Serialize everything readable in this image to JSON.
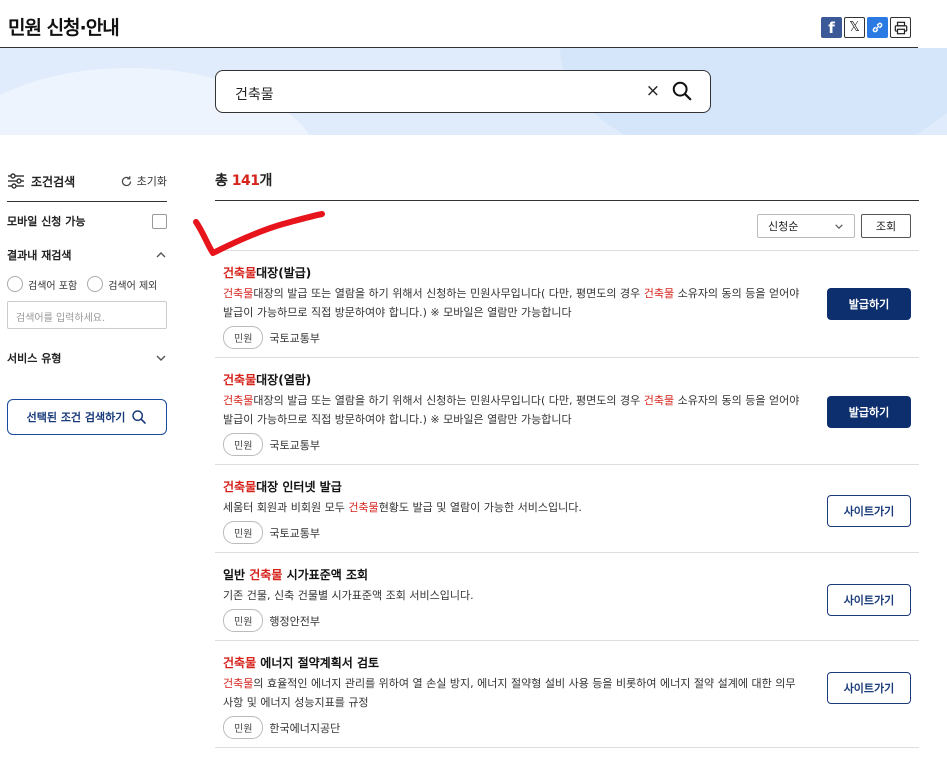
{
  "header": {
    "title": "민원 신청·안내",
    "share": {
      "facebook": "f",
      "x": "𝕏"
    }
  },
  "search": {
    "query": "건축물",
    "clear_label": "×"
  },
  "sidebar": {
    "title": "조건검색",
    "reset_label": "초기화",
    "mobile_label": "모바일 신청 가능",
    "refine_label": "결과내 재검색",
    "include_label": "검색어 포함",
    "exclude_label": "검색어 제외",
    "input_placeholder": "검색어를 입력하세요.",
    "service_type_label": "서비스 유형",
    "submit_label": "선택된 조건 검색하기"
  },
  "results_header": {
    "total_prefix": "총 ",
    "total_count": "141",
    "total_suffix": "개",
    "sort_value": "신청순",
    "sort_button": "조회"
  },
  "results": [
    {
      "title_hl": "건축물",
      "title_rest": "대장(발급)",
      "desc_parts": [
        "",
        "건축물",
        "대장의 발급 또는 열람을 하기 위해서 신청하는 민원사무입니다( 다만, 평면도의 경우 ",
        "건축물",
        " 소유자의 동의 등을 얻어야 발급이 가능하므로 직접 방문하여야 합니다.) ※ 모바일은 열람만 가능합니다"
      ],
      "tag": "민원",
      "agency": "국토교통부",
      "button": "발급하기",
      "button_style": "primary"
    },
    {
      "title_hl": "건축물",
      "title_rest": "대장(열람)",
      "desc_parts": [
        "",
        "건축물",
        "대장의 발급 또는 열람을 하기 위해서 신청하는 민원사무입니다( 다만, 평면도의 경우 ",
        "건축물",
        " 소유자의 동의 등을 얻어야 발급이 가능하므로 직접 방문하여야 합니다.) ※ 모바일은 열람만 가능합니다"
      ],
      "tag": "민원",
      "agency": "국토교통부",
      "button": "발급하기",
      "button_style": "primary"
    },
    {
      "title_hl": "건축물",
      "title_rest": "대장 인터넷 발급",
      "desc_parts": [
        "세움터 회원과 비회원 모두 ",
        "건축물",
        "현황도 발급 및 열람이 가능한 서비스입니다."
      ],
      "tag": "민원",
      "agency": "국토교통부",
      "button": "사이트가기",
      "button_style": "outline"
    },
    {
      "title_pre": "일반 ",
      "title_hl": "건축물",
      "title_rest": " 시가표준액 조회",
      "desc_parts": [
        "기존 건물, 신축 건물별 시가표준액 조회 서비스입니다."
      ],
      "tag": "민원",
      "agency": "행정안전부",
      "button": "사이트가기",
      "button_style": "outline"
    },
    {
      "title_hl": "건축물",
      "title_rest": " 에너지 절약계획서 검토",
      "desc_parts": [
        "",
        "건축물",
        "의 효율적인 에너지 관리를 위하여 열 손실 방지, 에너지 절약형 설비 사용 등을 비롯하여 에너지 절약 설계에 대한 의무사항 및 에너지 성능지표를 규정"
      ],
      "tag": "민원",
      "agency": "한국에너지공단",
      "button": "사이트가기",
      "button_style": "outline"
    }
  ],
  "colors": {
    "accent_red": "#d6231c",
    "navy": "#0d2f6e",
    "banner": "#e0ecfb"
  }
}
